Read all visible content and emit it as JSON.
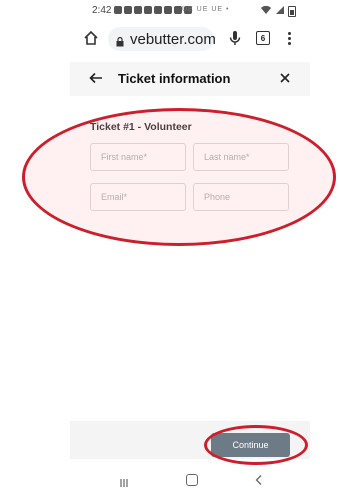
{
  "status_bar": {
    "time": "2:42",
    "notif_text": "UE UE UE  •",
    "signal_text": "⌗ ▲"
  },
  "browser": {
    "url": "vebutter.com",
    "tab_count": "6"
  },
  "modal": {
    "title": "Ticket information",
    "ticket_label": "Ticket #1 - Volunteer"
  },
  "form": {
    "first_name_placeholder": "First name*",
    "last_name_placeholder": "Last name*",
    "email_placeholder": "Email*",
    "phone_placeholder": "Phone",
    "first_name_value": "",
    "last_name_value": "",
    "email_value": "",
    "phone_value": ""
  },
  "footer": {
    "continue_label": "Continue"
  },
  "colors": {
    "annotation_red": "#cc1f2b",
    "button_bg": "#6d7b86"
  }
}
